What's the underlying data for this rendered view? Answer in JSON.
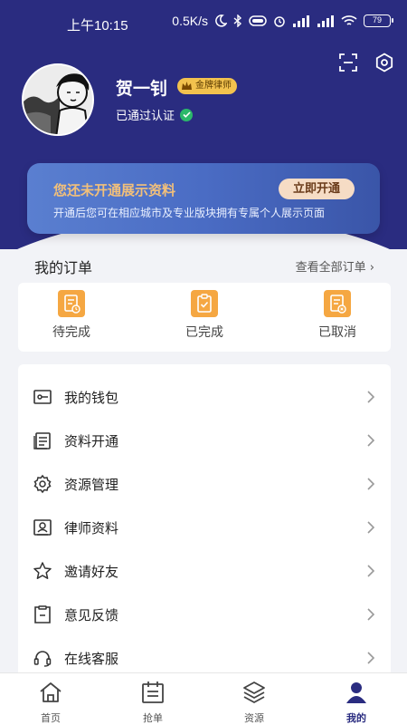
{
  "status_bar": {
    "time": "上午10:15",
    "speed": "0.5K/s",
    "battery": "79"
  },
  "profile": {
    "name": "贺一钊",
    "badge": "金牌律师",
    "verified": "已通过认证"
  },
  "promo": {
    "title": "您还未开通展示资料",
    "button": "立即开通",
    "description": "开通后您可在相应城市及专业版块拥有专属个人展示页面"
  },
  "orders": {
    "title": "我的订单",
    "view_all": "查看全部订单 ›",
    "items": [
      {
        "label": "待完成",
        "icon": "pending-order-icon"
      },
      {
        "label": "已完成",
        "icon": "completed-order-icon"
      },
      {
        "label": "已取消",
        "icon": "cancelled-order-icon"
      }
    ]
  },
  "menu": [
    {
      "label": "我的钱包",
      "icon": "wallet-icon"
    },
    {
      "label": "资料开通",
      "icon": "document-icon"
    },
    {
      "label": "资源管理",
      "icon": "settings-gear-icon"
    },
    {
      "label": "律师资料",
      "icon": "profile-card-icon"
    },
    {
      "label": "邀请好友",
      "icon": "star-icon"
    },
    {
      "label": "意见反馈",
      "icon": "feedback-icon"
    },
    {
      "label": "在线客服",
      "icon": "headset-icon"
    }
  ],
  "tabbar": [
    {
      "label": "首页",
      "icon": "home-icon"
    },
    {
      "label": "抢单",
      "icon": "calendar-icon"
    },
    {
      "label": "资源",
      "icon": "layers-icon"
    },
    {
      "label": "我的",
      "icon": "user-icon"
    }
  ],
  "colors": {
    "header_bg": "#2a2c80",
    "accent_orange": "#f5a742",
    "promo_title": "#f2c07a",
    "verified_green": "#2bb86a"
  }
}
